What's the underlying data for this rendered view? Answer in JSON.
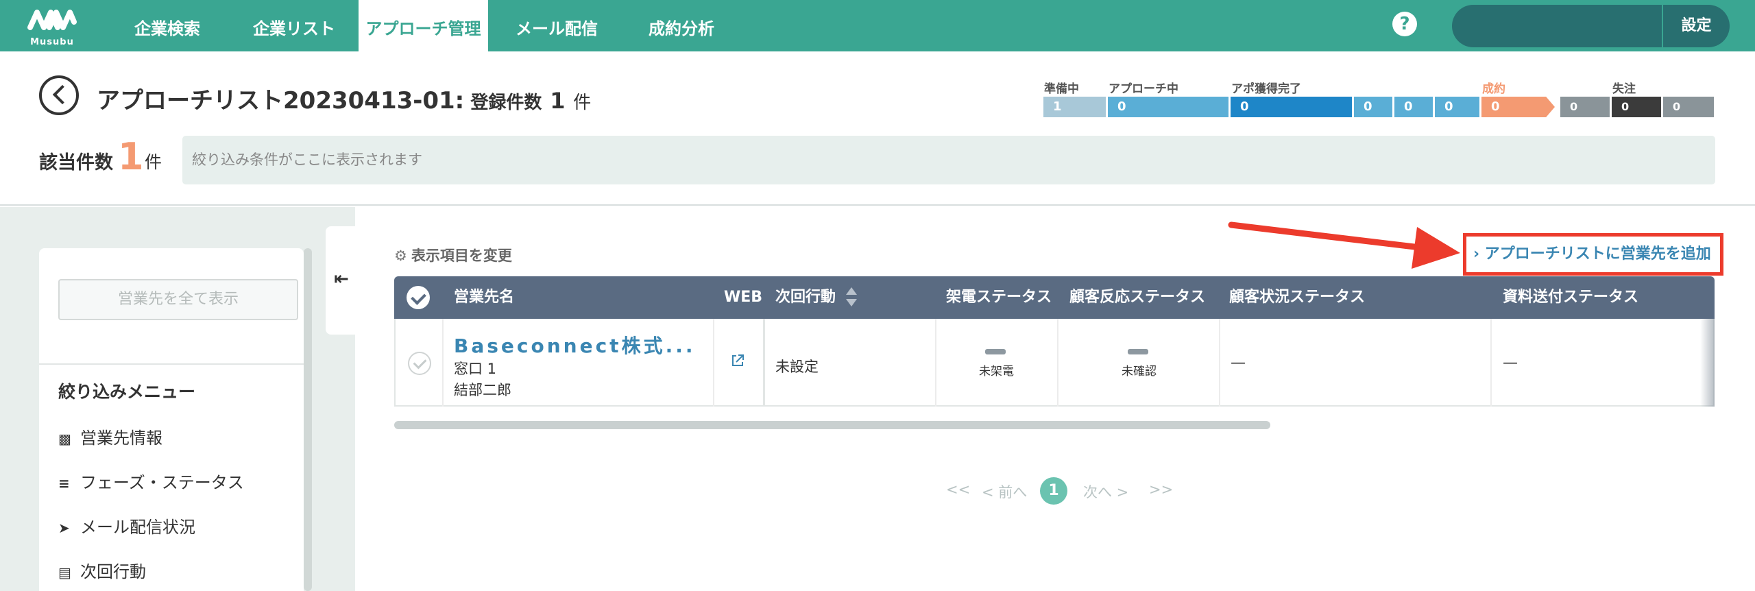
{
  "nav": {
    "logo_text": "Musubu",
    "items": [
      {
        "label": "企業検索",
        "active": false
      },
      {
        "label": "企業リスト",
        "active": false
      },
      {
        "label": "アプローチ管理",
        "active": true
      },
      {
        "label": "メール配信",
        "active": false
      },
      {
        "label": "成約分析",
        "active": false
      }
    ],
    "help_label": "?",
    "settings_label": "設定"
  },
  "header": {
    "title": "アプローチリスト20230413-01:",
    "registered_label": " 登録件数",
    "registered_count": "1",
    "registered_unit": "件"
  },
  "phases": {
    "labels": [
      "準備中",
      "アプローチ中",
      "アポ獲得完了",
      "成約",
      "失注"
    ],
    "values": [
      "1",
      "0",
      "0",
      "0",
      "0",
      "0",
      "0",
      "0",
      "0",
      "0"
    ],
    "colors": {
      "preparing": "#a8c8d8",
      "approaching": "#5aaed6",
      "appointment": "#1e86c8",
      "appointment_sub": "#5aaed6",
      "contract": "#f49a72",
      "lost": "#8a9499",
      "lost_dark": "#3b3b3b"
    }
  },
  "summary": {
    "count_label": "該当件数",
    "count": "1",
    "unit": "件",
    "filter_placeholder": "絞り込み条件がここに表示されます"
  },
  "sidebar": {
    "show_all_label": "営業先を全て表示",
    "menu_title": "絞り込みメニュー",
    "items": [
      {
        "label": "営業先情報",
        "icon": "building-icon"
      },
      {
        "label": "フェーズ・ステータス",
        "icon": "checklist-icon"
      },
      {
        "label": "メール配信状況",
        "icon": "send-icon"
      },
      {
        "label": "次回行動",
        "icon": "calendar-icon"
      }
    ]
  },
  "main": {
    "change_columns_label": "表示項目を変更",
    "add_link_label": "アプローチリストに営業先を追加",
    "table": {
      "headers": [
        "営業先名",
        "WEB",
        "次回行動",
        "架電ステータス",
        "顧客反応ステータス",
        "顧客状況ステータス",
        "資料送付ステータス"
      ],
      "rows": [
        {
          "company": "Baseconnect株式...",
          "contact_window": "窓口 1",
          "contact_name": "結部二郎",
          "next_action": "未設定",
          "call_status": "未架電",
          "reaction_status": "未確認",
          "situation_status": "—",
          "document_status": "—"
        }
      ]
    },
    "pagination": {
      "first": "<<",
      "prev": "< 前へ",
      "current": "1",
      "next": "次へ >",
      "last": ">>"
    }
  },
  "colors": {
    "brand": "#3aa692",
    "table_header": "#5a6b82",
    "link": "#3a86b2",
    "highlight": "#ec3b2c"
  }
}
